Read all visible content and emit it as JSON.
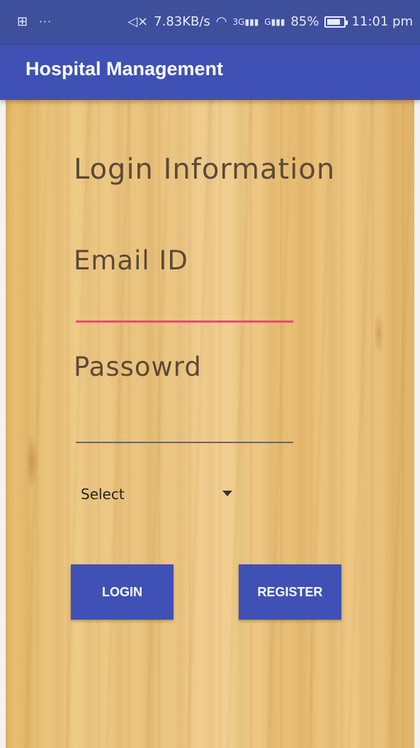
{
  "status_bar": {
    "left_icon": "usb-debug-icon",
    "dots": "···",
    "mute": "◁×",
    "speed": "7.83KB/s",
    "wifi": "wifi-icon",
    "sim1": "3G",
    "sim2": "G",
    "battery": "85%",
    "time": "11:01 pm"
  },
  "appbar": {
    "title": "Hospital Management"
  },
  "form": {
    "heading": "Login Information",
    "email_label": "Email ID",
    "password_label": "Passowrd",
    "select_value": "Select"
  },
  "buttons": {
    "login": "LOGIN",
    "register": "REGISTER"
  },
  "colors": {
    "primary": "#3f51b5",
    "status_bar": "#3e4f9c",
    "accent": "#f2447f"
  }
}
